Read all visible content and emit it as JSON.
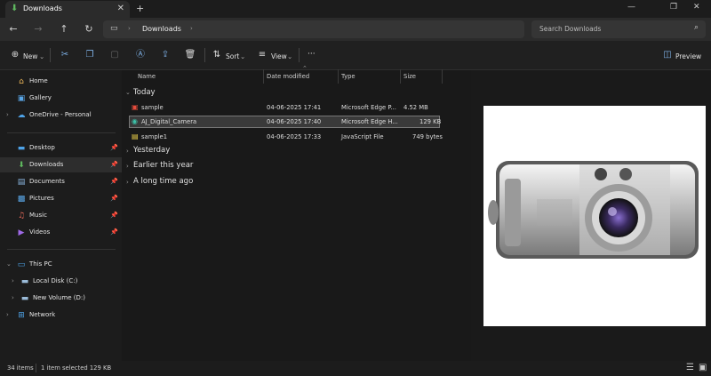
{
  "window": {
    "tab_title": "Downloads",
    "tab_close": "✕",
    "new_tab": "+",
    "controls": [
      "—",
      "❐",
      "✕"
    ]
  },
  "address": {
    "breadcrumb": "Downloads",
    "search_placeholder": "Search Downloads"
  },
  "toolbar": {
    "new_label": "New",
    "sort_label": "Sort",
    "view_label": "View",
    "more_label": "···",
    "preview_label": "Preview"
  },
  "sidebar": {
    "top": [
      {
        "label": "Home",
        "icon": "home-icon"
      },
      {
        "label": "Gallery",
        "icon": "gallery-icon"
      },
      {
        "label": "OneDrive - Personal",
        "icon": "cloud-icon"
      }
    ],
    "pinned": [
      {
        "label": "Desktop",
        "icon": "desktop-icon"
      },
      {
        "label": "Downloads",
        "icon": "download-icon"
      },
      {
        "label": "Documents",
        "icon": "documents-icon"
      },
      {
        "label": "Pictures",
        "icon": "pictures-icon"
      },
      {
        "label": "Music",
        "icon": "music-icon"
      },
      {
        "label": "Videos",
        "icon": "videos-icon"
      }
    ],
    "this_pc": "This PC",
    "drives": [
      {
        "label": "Local Disk (C:)"
      },
      {
        "label": "New Volume (D:)"
      }
    ],
    "network": "Network"
  },
  "list": {
    "columns": [
      "Name",
      "Date modified",
      "Type",
      "Size"
    ],
    "groups": {
      "today": "Today",
      "yesterday": "Yesterday",
      "earlier": "Earlier this year",
      "long_ago": "A long time ago"
    },
    "files": [
      {
        "name": "sample",
        "date": "04-06-2025 17:41",
        "type": "Microsoft Edge P...",
        "size": "4.52 MB",
        "icon": "pdf-icon"
      },
      {
        "name": "AJ_Digital_Camera",
        "date": "04-06-2025 17:40",
        "type": "Microsoft Edge H...",
        "size": "129 KB",
        "icon": "edge-icon"
      },
      {
        "name": "sample1",
        "date": "04-06-2025 17:33",
        "type": "JavaScript File",
        "size": "749 bytes",
        "icon": "js-icon"
      }
    ]
  },
  "status": {
    "items": "34 items",
    "selected": "1 item selected  129 KB"
  },
  "colors": {
    "accent": "#5fb85f",
    "selection": "#3a3a3a"
  }
}
